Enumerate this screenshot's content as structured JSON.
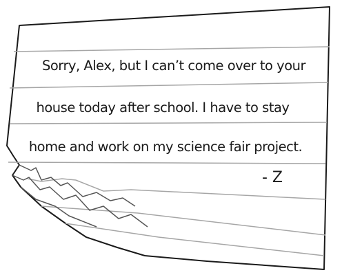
{
  "note": {
    "lines": [
      "Sorry, Alex, but I can’t come over to your",
      "house today after school. I have to stay",
      "home and work on my science fair project."
    ],
    "signature": "- Z"
  },
  "colors": {
    "paper": "#ffffff",
    "ink": "#1a1a1a",
    "rule_lines": "#a6a6a6"
  }
}
